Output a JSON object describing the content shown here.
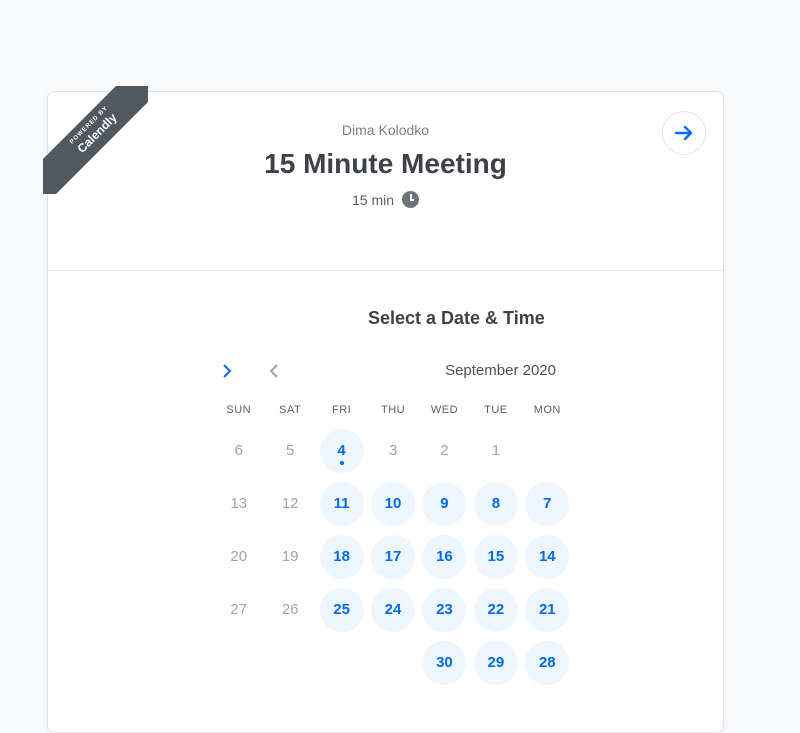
{
  "ribbon": {
    "powered_by": "POWERED BY",
    "brand": "Calendly"
  },
  "header": {
    "organizer": "Dima Kolodko",
    "event_title": "15 Minute Meeting",
    "duration": "15 min"
  },
  "icons": {
    "arrow": "arrow-right-icon",
    "clock": "clock-icon"
  },
  "colors": {
    "accent": "#0069ff",
    "available_bg": "#eef6ff"
  },
  "picker": {
    "title": "Select a Date & Time",
    "month": "September 2020",
    "weekdays": [
      "MON",
      "TUE",
      "WED",
      "THU",
      "FRI",
      "SAT",
      "SUN"
    ],
    "weeks": [
      [
        {
          "d": ""
        },
        {
          "d": "1",
          "s": "m"
        },
        {
          "d": "2",
          "s": "m"
        },
        {
          "d": "3",
          "s": "m"
        },
        {
          "d": "4",
          "s": "a",
          "today": true
        },
        {
          "d": "5",
          "s": "m"
        },
        {
          "d": "6",
          "s": "m"
        }
      ],
      [
        {
          "d": "7",
          "s": "a"
        },
        {
          "d": "8",
          "s": "a"
        },
        {
          "d": "9",
          "s": "a"
        },
        {
          "d": "10",
          "s": "a"
        },
        {
          "d": "11",
          "s": "a"
        },
        {
          "d": "12",
          "s": "m"
        },
        {
          "d": "13",
          "s": "m"
        }
      ],
      [
        {
          "d": "14",
          "s": "a"
        },
        {
          "d": "15",
          "s": "a"
        },
        {
          "d": "16",
          "s": "a"
        },
        {
          "d": "17",
          "s": "a"
        },
        {
          "d": "18",
          "s": "a"
        },
        {
          "d": "19",
          "s": "m"
        },
        {
          "d": "20",
          "s": "m"
        }
      ],
      [
        {
          "d": "21",
          "s": "a"
        },
        {
          "d": "22",
          "s": "a"
        },
        {
          "d": "23",
          "s": "a"
        },
        {
          "d": "24",
          "s": "a"
        },
        {
          "d": "25",
          "s": "a"
        },
        {
          "d": "26",
          "s": "m"
        },
        {
          "d": "27",
          "s": "m"
        }
      ],
      [
        {
          "d": "28",
          "s": "a"
        },
        {
          "d": "29",
          "s": "a"
        },
        {
          "d": "30",
          "s": "a"
        },
        {
          "d": ""
        },
        {
          "d": ""
        },
        {
          "d": ""
        },
        {
          "d": ""
        }
      ]
    ]
  }
}
